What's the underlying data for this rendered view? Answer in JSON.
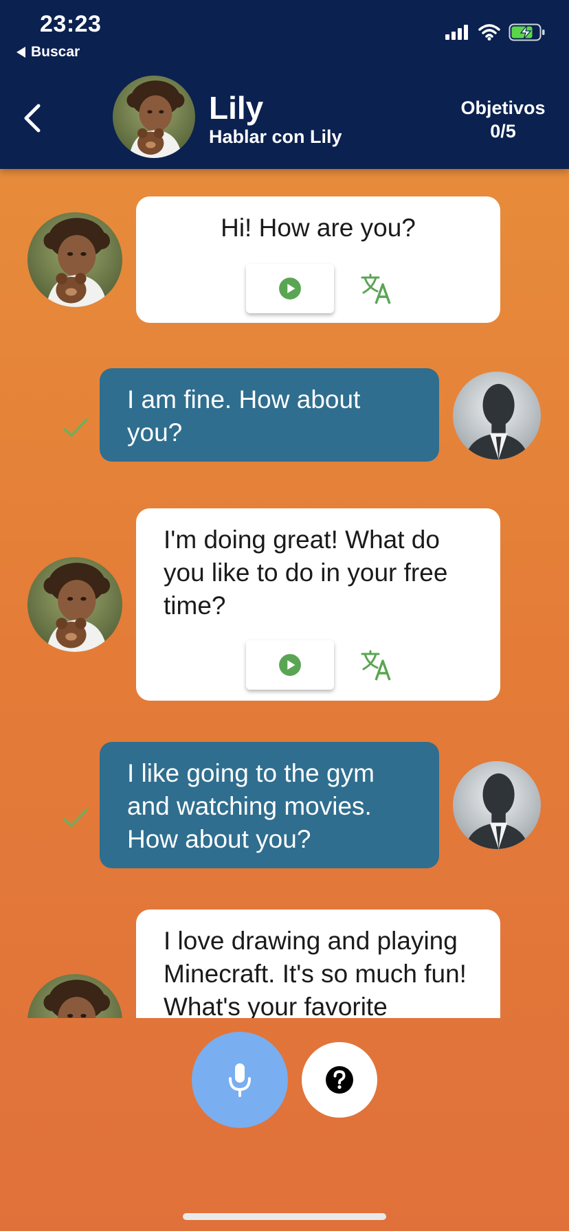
{
  "status_bar": {
    "time": "23:23",
    "back_app_label": "Buscar",
    "battery_color": "#5bd64a"
  },
  "header": {
    "name": "Lily",
    "subtitle": "Hablar con Lily",
    "goals_label": "Objetivos",
    "goals_value": "0/5",
    "background": "#0b2150"
  },
  "messages": [
    {
      "sender": "bot",
      "text": "Hi! How are you?",
      "has_actions": true
    },
    {
      "sender": "user",
      "text": "I am fine. How about you?",
      "status": "check"
    },
    {
      "sender": "bot",
      "text": "I'm doing great! What do you like to do in your free time?",
      "has_actions": true
    },
    {
      "sender": "user",
      "text": "I like going to the gym and watching movies. How about you?",
      "status": "check"
    },
    {
      "sender": "bot",
      "text": "I love drawing and playing Minecraft. It's so much fun! What's your favorite",
      "has_actions": false
    }
  ],
  "icons": {
    "back": "chevron-left-icon",
    "play": "play-circle-icon",
    "translate": "translate-icon",
    "check": "check-icon",
    "mic": "microphone-icon",
    "help": "question-circle-icon"
  },
  "colors": {
    "user_bubble": "#2f6e8f",
    "accent_green": "#5aa553",
    "mic_button": "#79aef0"
  }
}
